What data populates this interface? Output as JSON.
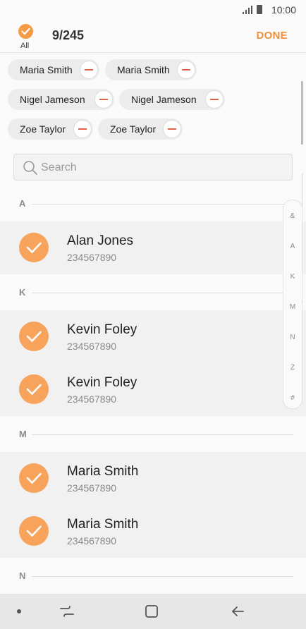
{
  "status_bar": {
    "time": "10:00"
  },
  "header": {
    "all_label": "All",
    "count": "9/245",
    "done_label": "DONE"
  },
  "selected_chips": [
    {
      "name": "Maria Smith"
    },
    {
      "name": "Maria Smith"
    },
    {
      "name": "Nigel Jameson"
    },
    {
      "name": "Nigel Jameson"
    },
    {
      "name": "Zoe Taylor"
    },
    {
      "name": "Zoe Taylor"
    }
  ],
  "search": {
    "placeholder": "Search"
  },
  "sections": [
    {
      "letter": "A",
      "contacts": [
        {
          "name": "Alan Jones",
          "phone": "234567890"
        }
      ]
    },
    {
      "letter": "K",
      "contacts": [
        {
          "name": "Kevin Foley",
          "phone": "234567890"
        },
        {
          "name": "Kevin Foley",
          "phone": "234567890"
        }
      ]
    },
    {
      "letter": "M",
      "contacts": [
        {
          "name": "Maria Smith",
          "phone": "234567890"
        },
        {
          "name": "Maria Smith",
          "phone": "234567890"
        }
      ]
    },
    {
      "letter": "N",
      "contacts": []
    }
  ],
  "index_letters": [
    "&",
    "A",
    "K",
    "M",
    "N",
    "Z",
    "#"
  ],
  "colors": {
    "accent": "#f0913a",
    "check_fill": "#f7a35b",
    "remove": "#e0624f"
  }
}
